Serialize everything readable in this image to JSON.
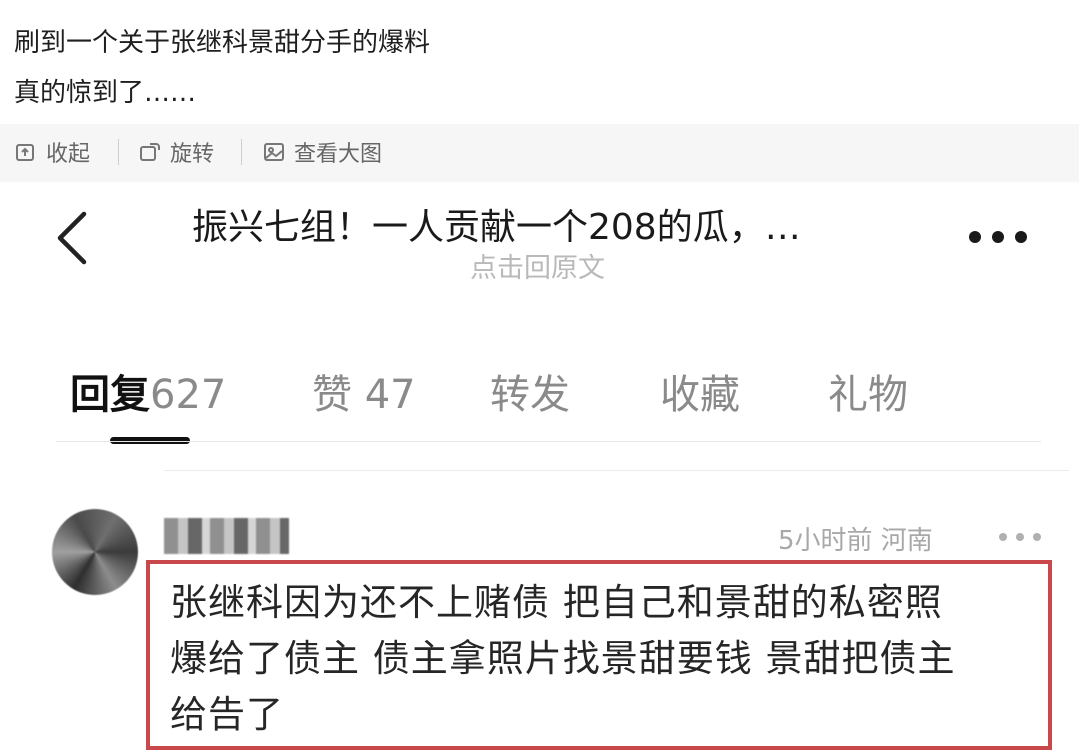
{
  "post": {
    "line1": "刷到一个关于张继科景甜分手的爆料",
    "line2": "真的惊到了……"
  },
  "toolbar": {
    "collapse_label": "收起",
    "rotate_label": "旋转",
    "view_large_label": "查看大图"
  },
  "screenshot": {
    "header": {
      "title": "振兴七组！一人贡献一个208的瓜，…",
      "subtitle": "点击回原文"
    },
    "tabs": [
      {
        "label": "回复",
        "count": "627",
        "active": true
      },
      {
        "label": "赞",
        "count": "47",
        "active": false
      },
      {
        "label": "转发",
        "count": "",
        "active": false
      },
      {
        "label": "收藏",
        "count": "",
        "active": false
      },
      {
        "label": "礼物",
        "count": "",
        "active": false
      }
    ],
    "comment": {
      "meta": "5小时前 河南",
      "lines": [
        "张继科因为还不上赌债 把自己和景甜的私密照",
        "爆给了债主 债主拿照片找景甜要钱 景甜把债主",
        "给告了"
      ],
      "highlight_color": "#c8484b"
    }
  }
}
